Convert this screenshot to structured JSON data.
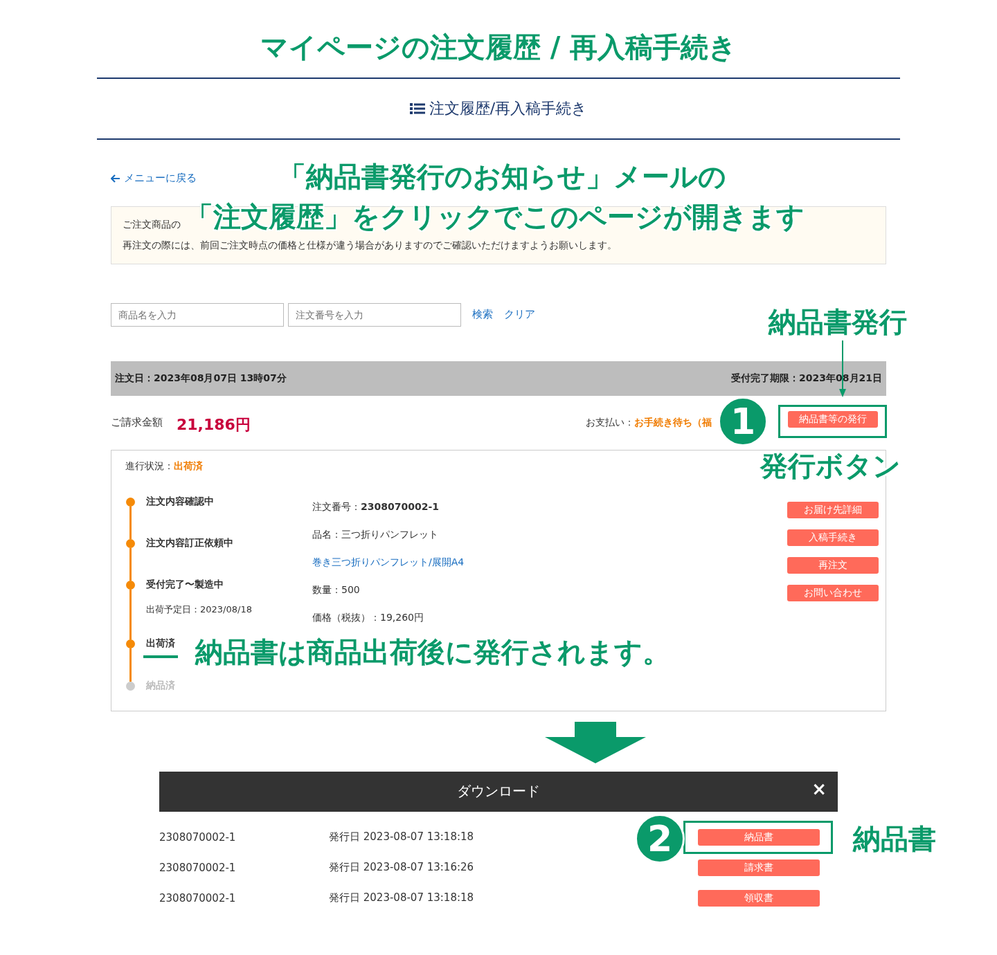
{
  "page_title": "マイページの注文履歴 / 再入稿手続き",
  "section_heading": "注文履歴/再入稿手続き",
  "back_link": "メニューに戻る",
  "notice": {
    "lines": [
      "ご注文商品の",
      "再注文の際には、前回ご注文時点の価格と仕様が違う場合がありますのでご確認いただけますようお願いします。"
    ]
  },
  "search": {
    "fields": [
      {
        "placeholder": "商品名を入力"
      },
      {
        "placeholder": "注文番号を入力"
      }
    ],
    "links": [
      "検索",
      "クリア"
    ]
  },
  "order": {
    "order_date": "注文日：2023年08月07日 13時07分",
    "deadline": "受付完了期限：2023年08月21日",
    "amount_label": "ご請求金額",
    "amount": "21,186円",
    "payment_label": "お支払い：",
    "payment_status": "お手続き待ち（福",
    "issue_button": "納品書等の発行",
    "progress_label": "進行状況：",
    "progress_value": "出荷済",
    "steps": [
      {
        "label": "注文内容確認中",
        "done": true,
        "highlighted": false
      },
      {
        "label": "注文内容訂正依頼中",
        "done": true,
        "highlighted": false
      },
      {
        "label": "受付完了〜製造中",
        "sub": "出荷予定日：2023/08/18",
        "done": true,
        "highlighted": false
      },
      {
        "label": "出荷済",
        "done": true,
        "highlighted": true
      },
      {
        "label": "納品済",
        "done": false,
        "highlighted": false
      }
    ],
    "details": [
      {
        "kind": "text",
        "text": "注文番号：**2308070002-1**"
      },
      {
        "kind": "text",
        "text": "品名：三つ折りパンフレット"
      },
      {
        "kind": "link",
        "text": "巻き三つ折りパンフレット/展開A4"
      },
      {
        "kind": "text",
        "text": "数量：500"
      },
      {
        "kind": "text",
        "text": "価格（税抜）：19,260円"
      }
    ],
    "actions": [
      "お届け先詳細",
      "入稿手続き",
      "再注文",
      "お問い合わせ"
    ]
  },
  "download": {
    "title": "ダウンロード",
    "close": "×",
    "rows": [
      {
        "number": "2308070002-1",
        "issued": "発行日 2023-08-07 13:18:18",
        "button": "納品書",
        "highlighted": true
      },
      {
        "number": "2308070002-1",
        "issued": "発行日 2023-08-07 13:16:26",
        "button": "請求書",
        "highlighted": false
      },
      {
        "number": "2308070002-1",
        "issued": "発行日 2023-08-07 13:18:18",
        "button": "領収書",
        "highlighted": false
      }
    ]
  },
  "annotations": {
    "mail_note": [
      "「納品書発行のお知らせ」メールの",
      "「注文履歴」をクリックでこのページが開きます"
    ],
    "issue_label": "納品書発行",
    "step1": "1",
    "button_note": "発行ボタン",
    "ship_note": "納品書は商品出荷後に発行されます。",
    "step2": "2",
    "doc_label": "納品書"
  }
}
